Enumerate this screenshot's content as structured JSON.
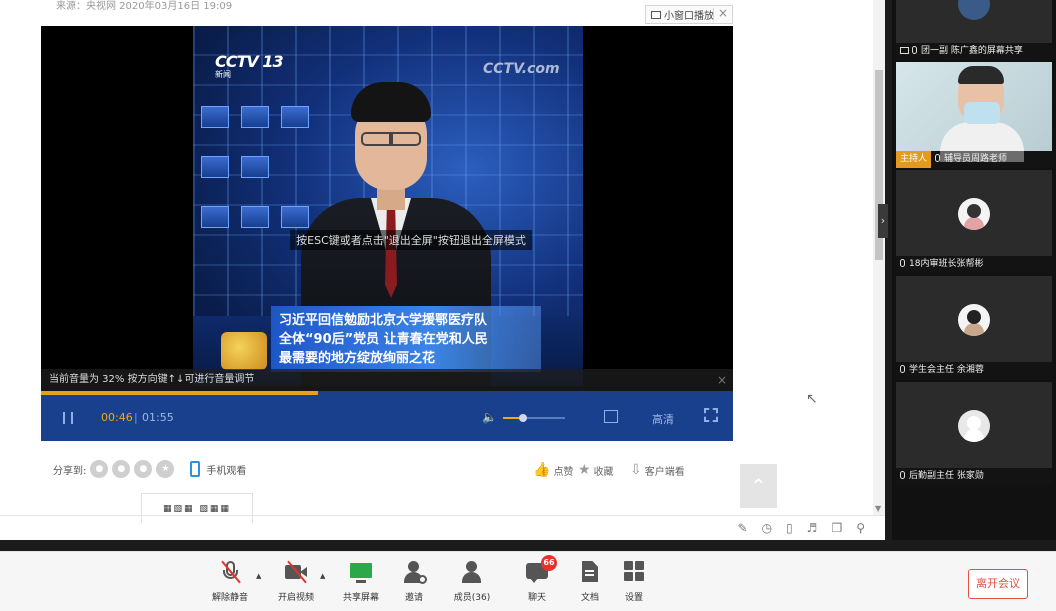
{
  "source_line": "来源：央视网 2020年03月16日 19:09",
  "player": {
    "mini_window_label": "小窗口播放",
    "close_symbol": "×",
    "esc_tip": "按ESC键或者点击\"退出全屏\"按钮退出全屏模式",
    "caption_lines": [
      "习近平回信勉励北京大学援鄂医疗队",
      "全体“90后”党员 让青春在党和人民",
      "最需要的地方绽放绚丽之花"
    ],
    "logo_text": "CCTV 13",
    "logo_sub": "新闻",
    "logo_com": "CCTV.com",
    "volume_tip": "当前音量为 32% 按方向键↑↓可进行音量调节",
    "volume_percent": 32,
    "current_time": "00:46",
    "duration": "01:55",
    "progress_fraction": 0.4,
    "quality_label": "高清"
  },
  "page_below": {
    "share_label": "分享到:",
    "mobile_watch_label": "手机观看",
    "like_label": "点赞",
    "favorite_label": "收藏",
    "client_label": "客户端看"
  },
  "gallery": {
    "tiles": [
      {
        "name": "团一副 陈广鑫的屏幕共享",
        "type": "screen"
      },
      {
        "name": "辅导员周路老师",
        "type": "camera",
        "host_tag": "主持人"
      },
      {
        "name": "18内审班长张帮彬",
        "type": "avatar"
      },
      {
        "name": "学生会主任 余湘蓉",
        "type": "avatar"
      },
      {
        "name": "后勤副主任 张家勋",
        "type": "avatar-gray"
      }
    ]
  },
  "toolbar": {
    "items": [
      {
        "label": "解除静音",
        "icon": "mic-muted-icon"
      },
      {
        "label": "开启视频",
        "icon": "camera-off-icon"
      },
      {
        "label": "共享屏幕",
        "icon": "share-screen-icon"
      },
      {
        "label": "邀请",
        "icon": "invite-icon"
      },
      {
        "label": "成员(36)",
        "icon": "members-icon"
      },
      {
        "label": "聊天",
        "icon": "chat-icon",
        "badge": "66"
      },
      {
        "label": "文档",
        "icon": "document-icon"
      },
      {
        "label": "设置",
        "icon": "settings-grid-icon"
      }
    ],
    "leave_label": "离开会议"
  },
  "colors": {
    "accent_orange": "#e8a020",
    "player_bar": "#18408d",
    "leave_red": "#e6503f",
    "badge_red": "#e5322c",
    "share_green": "#2ba84a"
  }
}
